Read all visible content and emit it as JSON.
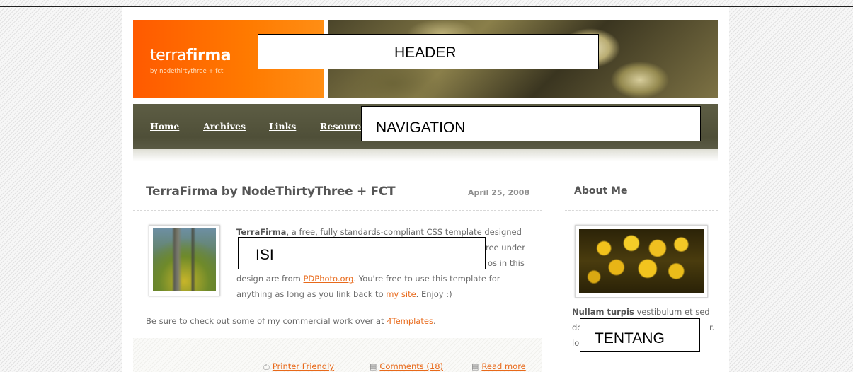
{
  "header": {
    "logo_plain": "terra",
    "logo_bold": "firma",
    "logo_sub": "by nodethirtythree + fct",
    "label": "HEADER"
  },
  "nav": {
    "label": "NAVIGATION",
    "items": [
      {
        "label": "Home"
      },
      {
        "label": "Archives"
      },
      {
        "label": "Links"
      },
      {
        "label": "Resource"
      }
    ]
  },
  "post": {
    "title": "TerraFirma by NodeThirtyThree + FCT",
    "date": "April 25, 2008",
    "label": "ISI",
    "p1_bold": "TerraFirma",
    "p1_line1": ", a free, fully standards-compliant CSS template designed",
    "p1_line2_end": "ree under",
    "p1_line3_end": "os in this",
    "p1_line4_a": "design are from ",
    "p1_link1": "PDPhoto.org",
    "p1_line4_b": ". You're free to use this template for",
    "p1_line5_a": "anything as long as you link back to ",
    "p1_link2": "my site",
    "p1_line5_b": ". Enjoy :)",
    "p2_a": "Be sure to check out some of my commercial work over at ",
    "p2_link": "4Templates",
    "p2_b": ".",
    "footer": {
      "printer": "Printer Friendly",
      "comments": "Comments (18)",
      "read_more": "Read more"
    }
  },
  "sidebar": {
    "title": "About Me",
    "label": "TENTANG",
    "text_bold": "Nullam turpis",
    "text_rest": " vestibulum et sed",
    "line2_start": "do",
    "line2_end": "r.",
    "line3_start": "lol"
  },
  "colors": {
    "logo_orange": "#ff6a00",
    "nav_olive": "#55553d",
    "link_orange": "#e8691a"
  }
}
